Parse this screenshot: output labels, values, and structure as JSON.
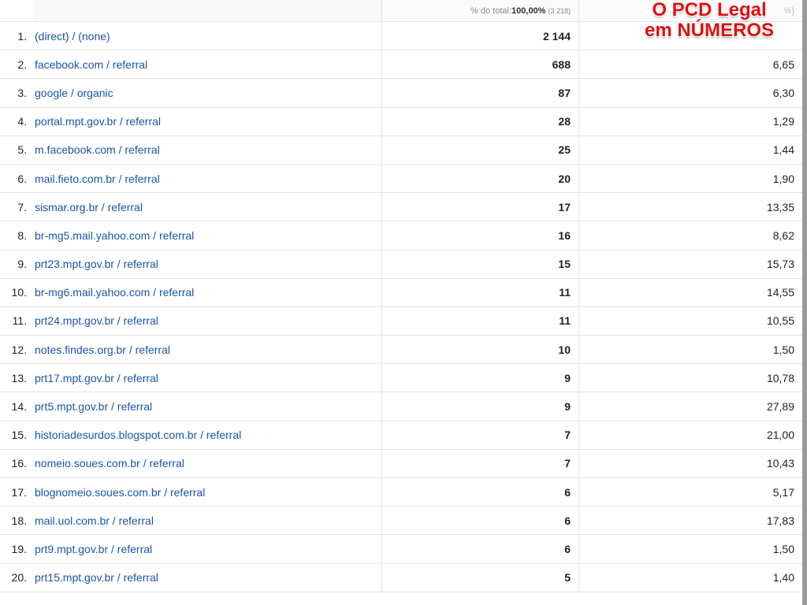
{
  "header": {
    "sessions_prefix": "% do total: ",
    "sessions_total_pct": "100,00%",
    "sessions_total_count": "(3 218)",
    "rate_partial": "%)"
  },
  "banner": {
    "line1": "O PCD Legal",
    "line2": "em NÚMEROS"
  },
  "rows": [
    {
      "idx": "1.",
      "source": "(direct) / (none)",
      "sessions": "2 144",
      "rate": ""
    },
    {
      "idx": "2.",
      "source": "facebook.com / referral",
      "sessions": "688",
      "rate": "6,65"
    },
    {
      "idx": "3.",
      "source": "google / organic",
      "sessions": "87",
      "rate": "6,30"
    },
    {
      "idx": "4.",
      "source": "portal.mpt.gov.br / referral",
      "sessions": "28",
      "rate": "1,29"
    },
    {
      "idx": "5.",
      "source": "m.facebook.com / referral",
      "sessions": "25",
      "rate": "1,44"
    },
    {
      "idx": "6.",
      "source": "mail.fieto.com.br / referral",
      "sessions": "20",
      "rate": "1,90"
    },
    {
      "idx": "7.",
      "source": "sismar.org.br / referral",
      "sessions": "17",
      "rate": "13,35"
    },
    {
      "idx": "8.",
      "source": "br-mg5.mail.yahoo.com / referral",
      "sessions": "16",
      "rate": "8,62"
    },
    {
      "idx": "9.",
      "source": "prt23.mpt.gov.br / referral",
      "sessions": "15",
      "rate": "15,73"
    },
    {
      "idx": "10.",
      "source": "br-mg6.mail.yahoo.com / referral",
      "sessions": "11",
      "rate": "14,55"
    },
    {
      "idx": "11.",
      "source": "prt24.mpt.gov.br / referral",
      "sessions": "11",
      "rate": "10,55"
    },
    {
      "idx": "12.",
      "source": "notes.findes.org.br / referral",
      "sessions": "10",
      "rate": "1,50"
    },
    {
      "idx": "13.",
      "source": "prt17.mpt.gov.br / referral",
      "sessions": "9",
      "rate": "10,78"
    },
    {
      "idx": "14.",
      "source": "prt5.mpt.gov.br / referral",
      "sessions": "9",
      "rate": "27,89"
    },
    {
      "idx": "15.",
      "source": "historiadesurdos.blogspot.com.br / referral",
      "sessions": "7",
      "rate": "21,00"
    },
    {
      "idx": "16.",
      "source": "nomeio.soues.com.br / referral",
      "sessions": "7",
      "rate": "10,43"
    },
    {
      "idx": "17.",
      "source": "blognomeio.soues.com.br / referral",
      "sessions": "6",
      "rate": "5,17"
    },
    {
      "idx": "18.",
      "source": "mail.uol.com.br / referral",
      "sessions": "6",
      "rate": "17,83"
    },
    {
      "idx": "19.",
      "source": "prt9.mpt.gov.br / referral",
      "sessions": "6",
      "rate": "1,50"
    },
    {
      "idx": "20.",
      "source": "prt15.mpt.gov.br / referral",
      "sessions": "5",
      "rate": "1,40"
    }
  ]
}
